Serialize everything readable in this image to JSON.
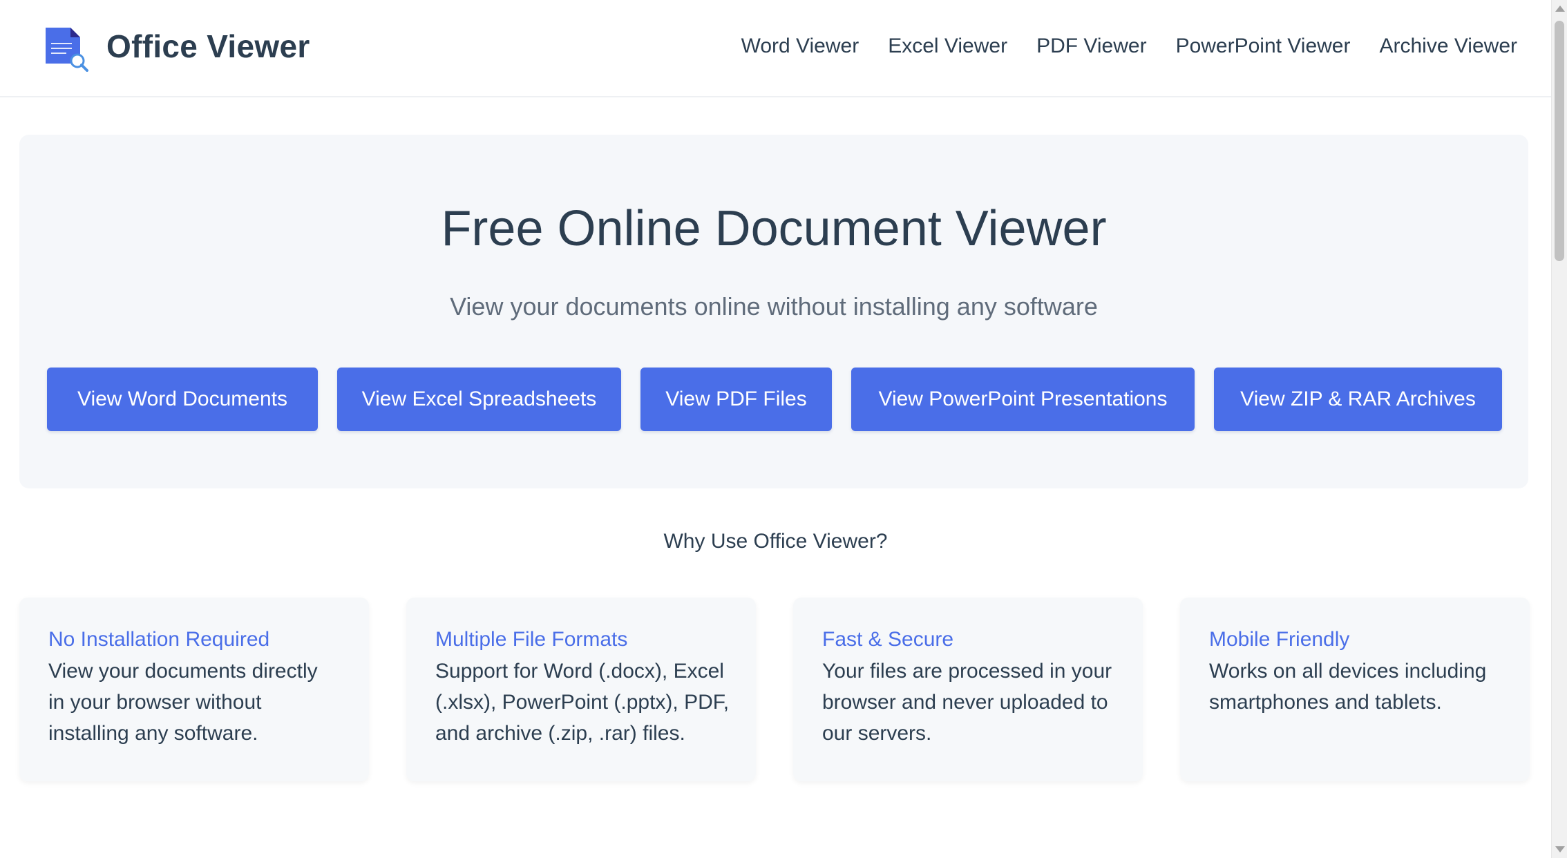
{
  "header": {
    "brand": "Office Viewer",
    "logo_icon": "document-search-icon",
    "nav": [
      {
        "label": "Word Viewer"
      },
      {
        "label": "Excel Viewer"
      },
      {
        "label": "PDF Viewer"
      },
      {
        "label": "PowerPoint Viewer"
      },
      {
        "label": "Archive Viewer"
      }
    ]
  },
  "hero": {
    "title": "Free Online Document Viewer",
    "subtitle": "View your documents online without installing any software",
    "buttons": [
      {
        "label": "View Word Documents"
      },
      {
        "label": "View Excel Spreadsheets"
      },
      {
        "label": "View PDF Files"
      },
      {
        "label": "View PowerPoint Presentations"
      },
      {
        "label": "View ZIP & RAR Archives"
      }
    ]
  },
  "why": {
    "title": "Why Use Office Viewer?",
    "features": [
      {
        "title": "No Installation Required",
        "text": "View your documents directly in your browser without installing any software."
      },
      {
        "title": "Multiple File Formats",
        "text": "Support for Word (.docx), Excel (.xlsx), PowerPoint (.pptx), PDF, and archive (.zip, .rar) files."
      },
      {
        "title": "Fast & Secure",
        "text": "Your files are processed in your browser and never uploaded to our servers."
      },
      {
        "title": "Mobile Friendly",
        "text": "Works on all devices including smartphones and tablets."
      }
    ]
  },
  "colors": {
    "accent": "#4a6ee8",
    "text": "#2c3e50",
    "muted": "#5f6b7a",
    "panel": "#f5f7fa"
  }
}
